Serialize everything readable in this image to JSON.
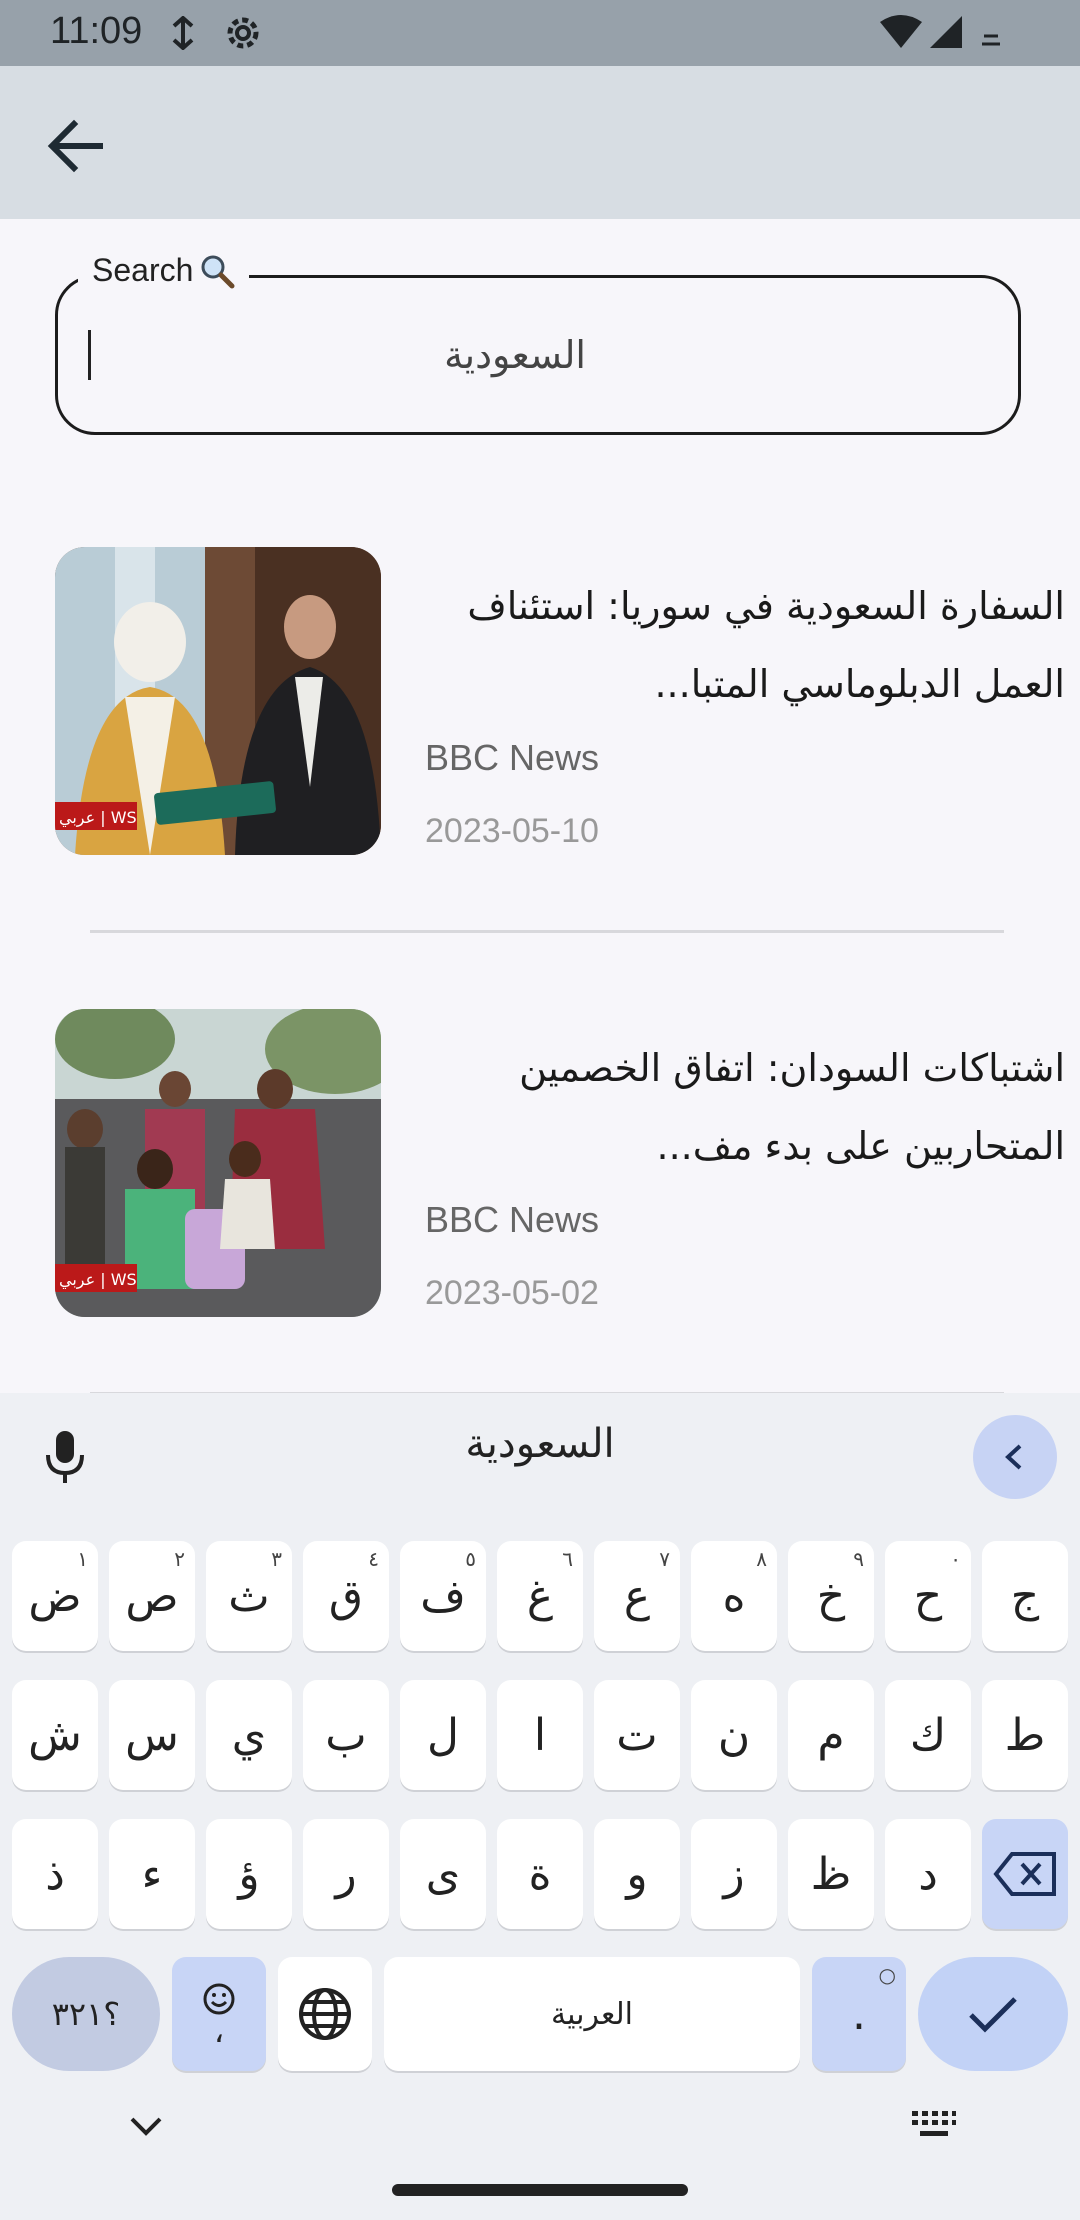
{
  "status_bar": {
    "time": "11:09"
  },
  "search": {
    "label": "Search",
    "value": "السعودية"
  },
  "articles": [
    {
      "title": "السفارة السعودية في سوريا: استئناف العمل الدبلوماسي المتبا...",
      "source": "BBC News",
      "date": "2023-05-10",
      "badge": "عربي | WS"
    },
    {
      "title": "اشتباكات السودان: اتفاق الخصمين المتحاربين على بدء مف...",
      "source": "BBC News",
      "date": "2023-05-02",
      "badge": "عربي | WS"
    }
  ],
  "keyboard": {
    "suggestion": "السعودية",
    "row1": [
      {
        "k": "ض",
        "h": "١"
      },
      {
        "k": "ص",
        "h": "٢"
      },
      {
        "k": "ث",
        "h": "٣"
      },
      {
        "k": "ق",
        "h": "٤"
      },
      {
        "k": "ف",
        "h": "٥"
      },
      {
        "k": "غ",
        "h": "٦"
      },
      {
        "k": "ع",
        "h": "٧"
      },
      {
        "k": "ه",
        "h": "٨"
      },
      {
        "k": "خ",
        "h": "٩"
      },
      {
        "k": "ح",
        "h": "٠"
      },
      {
        "k": "ج",
        "h": ""
      }
    ],
    "row2": [
      "ش",
      "س",
      "ي",
      "ب",
      "ل",
      "ا",
      "ت",
      "ن",
      "م",
      "ك",
      "ط"
    ],
    "row3": [
      "ذ",
      "ء",
      "ؤ",
      "ر",
      "ى",
      "ة",
      "و",
      "ز",
      "ظ",
      "د"
    ],
    "symbols_key": "؟٣٢١",
    "emoji_comma": "،",
    "space_label": "العربية",
    "period": ".",
    "period_hint": "○"
  }
}
